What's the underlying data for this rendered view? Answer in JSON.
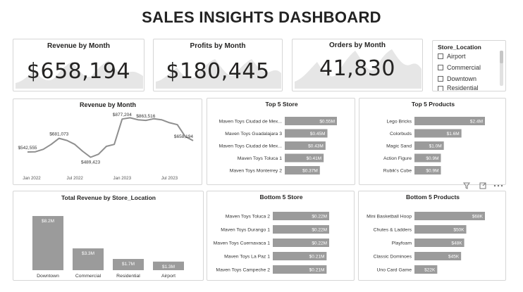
{
  "header": {
    "title": "SALES INSIGHTS DASHBOARD"
  },
  "colors": {
    "bar": "#9b9b9b",
    "line": "#8f8f8f",
    "area": "#e6e6e6",
    "text": "#252423",
    "border": "#d6d6d6"
  },
  "kpis": {
    "revenue": {
      "title": "Revenue by Month",
      "value": "$658,194"
    },
    "profits": {
      "title": "Profits by Month",
      "value": "$180,445"
    },
    "orders": {
      "title": "Orders by Month",
      "value": "41,830"
    }
  },
  "slicer": {
    "title": "Store_Location",
    "items": [
      "Airport",
      "Commercial",
      "Downtown",
      "Residential"
    ]
  },
  "visual_header_icons": [
    "filter-icon",
    "focus-mode-icon",
    "more-options-icon"
  ],
  "chart_data": [
    {
      "id": "revenue_line",
      "type": "line",
      "title": "Revenue by Month",
      "x_ticks": [
        "Jan 2022",
        "Jul 2022",
        "Jan 2023",
        "Jul 2023"
      ],
      "values": [
        542555,
        545000,
        570000,
        620000,
        681073,
        660000,
        620000,
        550000,
        489423,
        520000,
        600000,
        620000,
        877204,
        890000,
        870000,
        863516,
        880000,
        870000,
        840000,
        820000,
        700000,
        658194
      ],
      "data_labels": [
        {
          "index": 0,
          "text": "$542,555"
        },
        {
          "index": 4,
          "text": "$681,073"
        },
        {
          "index": 8,
          "text": "$489,423"
        },
        {
          "index": 12,
          "text": "$877,204"
        },
        {
          "index": 15,
          "text": "$863,516"
        },
        {
          "index": 21,
          "text": "$658,194"
        }
      ],
      "ylim": [
        400000,
        950000
      ]
    },
    {
      "id": "top5_store",
      "type": "bar",
      "title": "Top 5 Store",
      "categories": [
        "Maven Toys Ciudad de Mex...",
        "Maven Toys Guadalajara 3",
        "Maven Toys Ciudad de Mex...",
        "Maven Toys Toluca 1",
        "Maven Toys Monterrey 2"
      ],
      "values": [
        0.55,
        0.45,
        0.43,
        0.41,
        0.37
      ],
      "labels": [
        "$0.55M",
        "$0.45M",
        "$0.43M",
        "$0.41M",
        "$0.37M"
      ],
      "xlim": [
        0,
        0.55
      ]
    },
    {
      "id": "top5_products",
      "type": "bar",
      "title": "Top 5 Products",
      "categories": [
        "Lego Bricks",
        "Colorbuds",
        "Magic Sand",
        "Action Figure",
        "Rubik's Cube"
      ],
      "values": [
        2.4,
        1.6,
        1.0,
        0.9,
        0.9
      ],
      "labels": [
        "$2.4M",
        "$1.6M",
        "$1.0M",
        "$0.9M",
        "$0.9M"
      ],
      "xlim": [
        0,
        2.4
      ]
    },
    {
      "id": "revenue_by_location",
      "type": "bar",
      "title": "Total Revenue by Store_Location",
      "categories": [
        "Downtown",
        "Commercial",
        "Residential",
        "Airport"
      ],
      "values": [
        8.2,
        3.3,
        1.7,
        1.3
      ],
      "labels": [
        "$8.2M",
        "$3.3M",
        "$1.7M",
        "$1.3M"
      ],
      "ylim": [
        0,
        8.2
      ]
    },
    {
      "id": "bottom5_store",
      "type": "bar",
      "title": "Bottom 5 Store",
      "categories": [
        "Maven Toys Toluca 2",
        "Maven Toys Durango 1",
        "Maven Toys Cuernavaca 1",
        "Maven Toys La Paz 1",
        "Maven Toys Campeche 2"
      ],
      "values": [
        0.22,
        0.22,
        0.22,
        0.21,
        0.21
      ],
      "labels": [
        "$0.22M",
        "$0.22M",
        "$0.22M",
        "$0.21M",
        "$0.21M"
      ],
      "xlim": [
        0,
        0.22
      ]
    },
    {
      "id": "bottom5_products",
      "type": "bar",
      "title": "Bottom 5 Products",
      "categories": [
        "Mini Basketball Hoop",
        "Chutes & Ladders",
        "Playfoam",
        "Classic Dominoes",
        "Uno Card Game"
      ],
      "values": [
        68,
        50,
        48,
        45,
        22
      ],
      "labels": [
        "$68K",
        "$50K",
        "$48K",
        "$45K",
        "$22K"
      ],
      "xlim": [
        0,
        68
      ]
    }
  ]
}
